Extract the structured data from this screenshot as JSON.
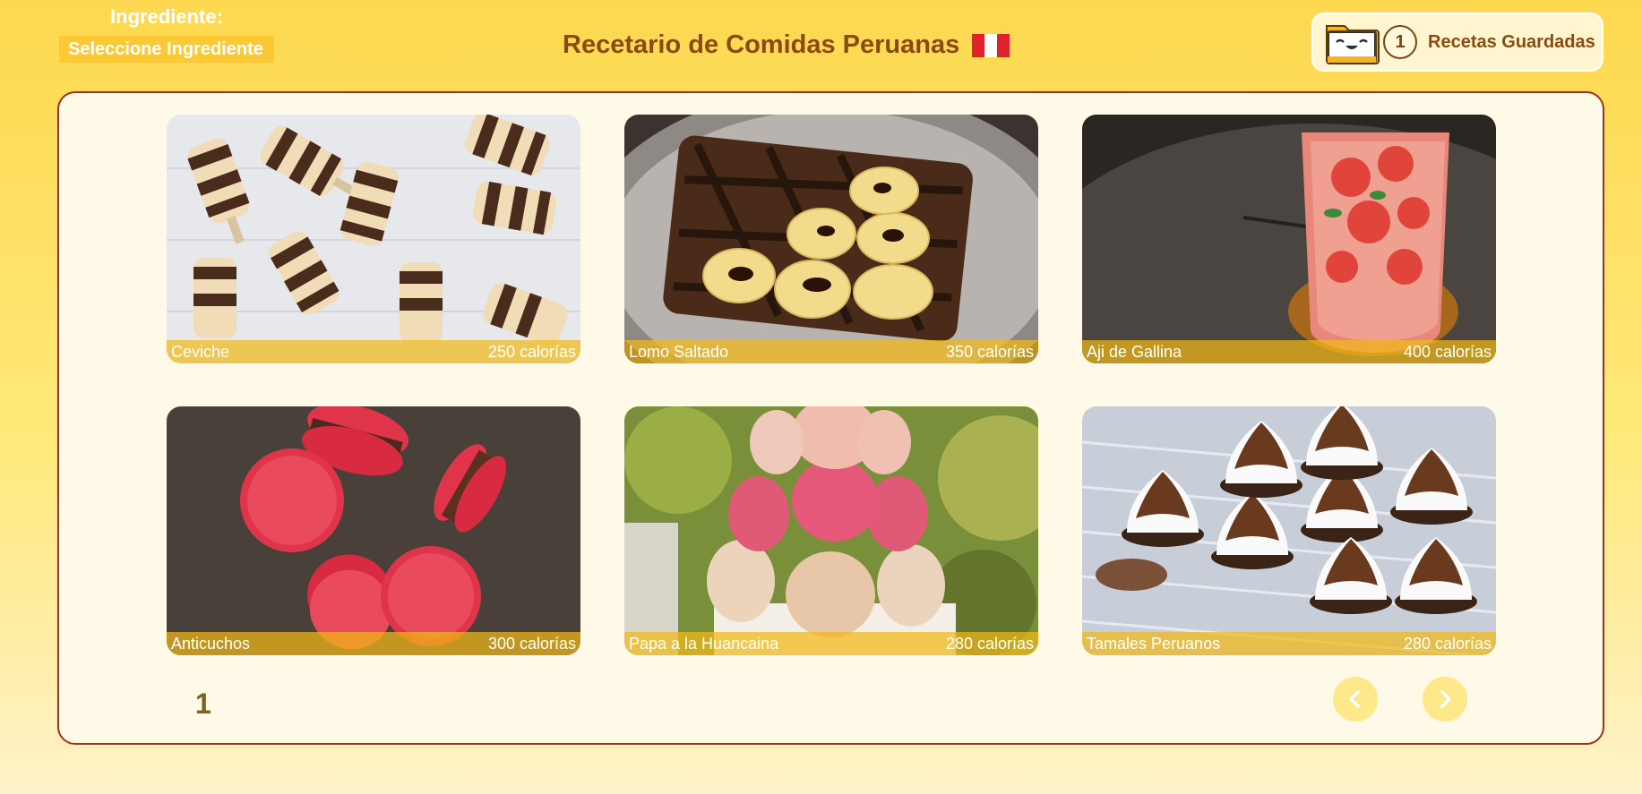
{
  "header": {
    "ingredient_label": "Ingrediente:",
    "ingredient_select_value": "Seleccione Ingrediente",
    "title": "Recetario de Comidas Peruanas",
    "saved_count": "1",
    "saved_label": "Recetas Guardadas"
  },
  "recipes": [
    {
      "name": "Ceviche",
      "calories": "250 calorías",
      "image": "popsicles-photo"
    },
    {
      "name": "Lomo Saltado",
      "calories": "350 calorías",
      "image": "banana-toast-photo"
    },
    {
      "name": "Aji de Gallina",
      "calories": "400 calorías",
      "image": "strawberry-drink-photo"
    },
    {
      "name": "Anticuchos",
      "calories": "300 calorías",
      "image": "macarons-photo"
    },
    {
      "name": "Papa a la Huancaina",
      "calories": "280 calorías",
      "image": "macaron-tower-photo"
    },
    {
      "name": "Tamales Peruanos",
      "calories": "280 calorías",
      "image": "chocolate-meringues-photo"
    }
  ],
  "pagination": {
    "current_page": "1",
    "prev_icon": "chevron-left-icon",
    "next_icon": "chevron-right-icon"
  },
  "colors": {
    "accent": "#fcc934",
    "title": "#8a4b10",
    "panel_border": "#a03415",
    "caption_bg": "#f1b818"
  }
}
